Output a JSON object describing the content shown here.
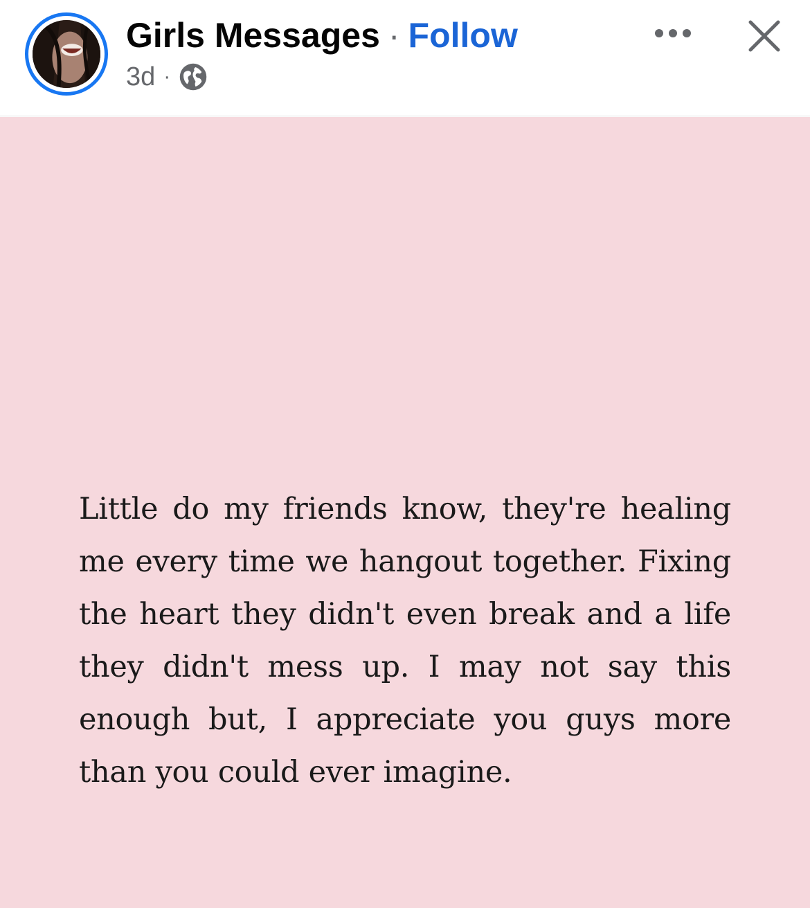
{
  "post": {
    "page_name": "Girls Messages",
    "separator": "·",
    "follow_label": "Follow",
    "timestamp": "3d",
    "meta_separator": "·",
    "privacy_icon": "globe-icon",
    "more_icon": "more-horizontal-icon",
    "close_icon": "close-icon",
    "avatar": "profile-avatar"
  },
  "image": {
    "background_color": "#f6d8dd",
    "quote": "Little do my friends know, they're healing me every time we hangout together. Fixing the heart they didn't even break and a life they didn't mess up. I may not say this enough but, I appreciate you guys more than you could ever imagine."
  },
  "colors": {
    "accent": "#1b65d6",
    "ring": "#1877f2",
    "text": "#050505",
    "secondary_text": "#65676b"
  }
}
